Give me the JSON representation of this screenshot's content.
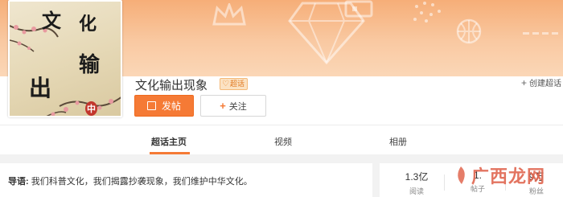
{
  "topic": {
    "title": "文化输出现象",
    "badge": "超话",
    "avatar_text": [
      "文",
      "化",
      "输",
      "出",
      "中"
    ]
  },
  "actions": {
    "create_label": "创建超话",
    "post_label": "发帖",
    "follow_label": "关注"
  },
  "tabs": [
    {
      "label": "超话主页",
      "active": true
    },
    {
      "label": "视频",
      "active": false
    },
    {
      "label": "相册",
      "active": false
    }
  ],
  "guide": {
    "prefix": "导语:",
    "text": "我们科普文化，我们揭露抄袭现象，我们维护中华文化。"
  },
  "stats": [
    {
      "value": "1.3亿",
      "label": "阅读"
    },
    {
      "value": "1.",
      "label": "帖子"
    },
    {
      "value": "9万",
      "label": "粉丝"
    }
  ],
  "watermark": "广西龙网",
  "colors": {
    "accent": "#f57a35",
    "banner": "#f6ae78",
    "badge_bg": "#fbe2c3"
  },
  "icons": {
    "badge": "heart-icon",
    "create": "plus-icon",
    "post": "edit-icon",
    "follow": "plus-icon"
  }
}
